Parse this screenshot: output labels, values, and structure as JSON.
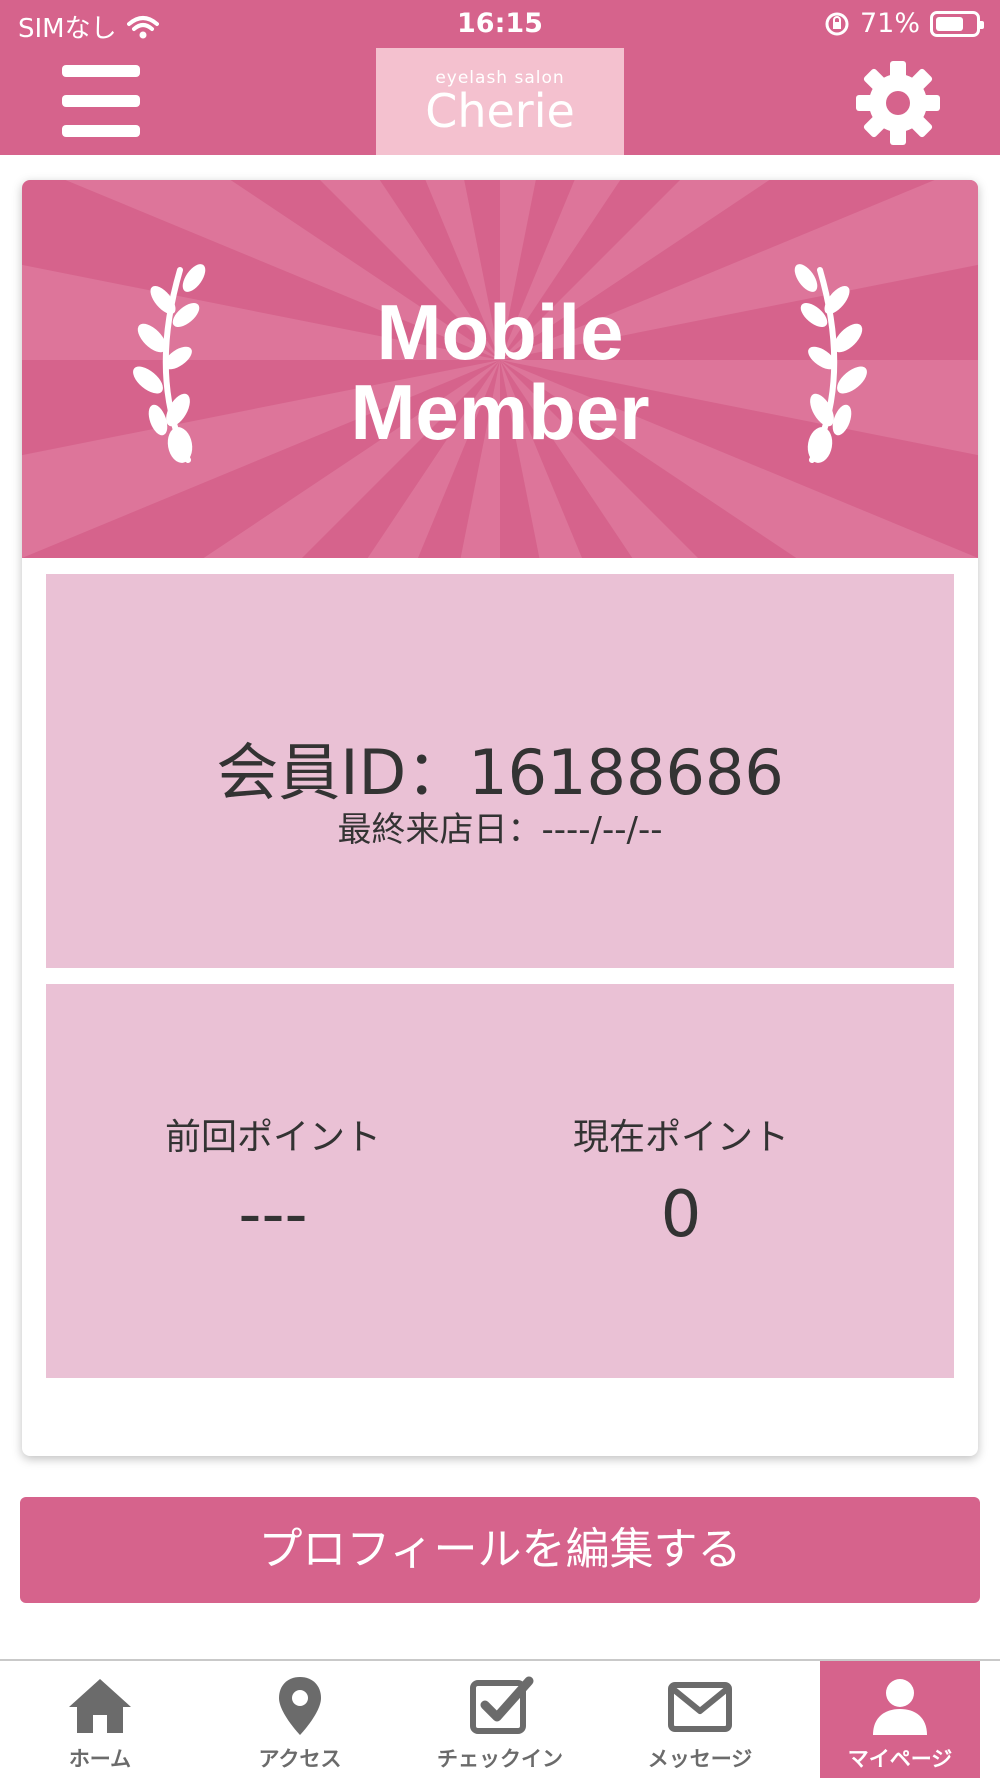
{
  "status_bar": {
    "carrier": "SIMなし",
    "time": "16:15",
    "battery_text": "71%",
    "battery_level": 0.71
  },
  "header": {
    "logo_sub": "eyelash salon",
    "logo_main": "Cherie",
    "menu_icon": "hamburger-menu-icon",
    "settings_icon": "gear-icon"
  },
  "banner": {
    "line1": "Mobile",
    "line2": "Member"
  },
  "member": {
    "id_text": "会員ID：16188686",
    "last_visit_text": "最終来店日：----/--/--"
  },
  "points": {
    "previous_label": "前回ポイント",
    "previous_value": "---",
    "current_label": "現在ポイント",
    "current_value": "0"
  },
  "edit_profile_label": "プロフィールを編集する",
  "tabs": [
    {
      "label": "ホーム",
      "icon": "home-icon",
      "active": false
    },
    {
      "label": "アクセス",
      "icon": "map-pin-icon",
      "active": false
    },
    {
      "label": "チェックイン",
      "icon": "checkbox-icon",
      "active": false
    },
    {
      "label": "メッセージ",
      "icon": "envelope-icon",
      "active": false
    },
    {
      "label": "マイページ",
      "icon": "user-icon",
      "active": true
    }
  ],
  "colors": {
    "brand_pink": "#d6638c",
    "logo_bg": "#f4c1cf",
    "panel_pink": "#eac1d5"
  }
}
